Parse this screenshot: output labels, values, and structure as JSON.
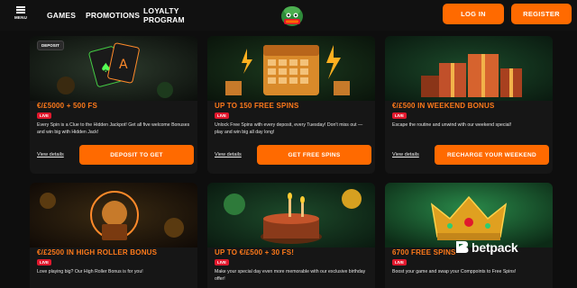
{
  "header": {
    "menu_label": "MENU",
    "nav": {
      "games": "GAMES",
      "promotions": "PROMOTIONS",
      "loyalty": "LOYALTY PROGRAM"
    },
    "login": "LOG IN",
    "register": "REGISTER",
    "logo_icon": "mascot-logo-icon"
  },
  "colors": {
    "accent": "#ff6a00",
    "title": "#ff7a1a",
    "live": "#e0182d",
    "background": "#0e0e0e"
  },
  "cards": [
    {
      "tag": "DEPOSIT",
      "title": "€/£5000 + 500 FS",
      "live": "LIVE",
      "description": "Every Spin is a Clue to the Hidden Jackpot! Get all five welcome Bonuses and win big with Hidden Jack!",
      "details": "View details",
      "cta": "DEPOSIT TO GET",
      "image_icon": "playing-cards-icon"
    },
    {
      "title": "UP TO 150 FREE SPINS",
      "live": "LIVE",
      "description": "Unlock Free Spins with every deposit, every Tuesday! Don't miss out — play and win big all day long!",
      "details": "View details",
      "cta": "GET FREE SPINS",
      "image_icon": "calendar-gifts-icon"
    },
    {
      "title": "€/£500 IN WEEKEND BONUS",
      "live": "LIVE",
      "description": "Escape the routine and unwind with our weekend special!",
      "details": "View details",
      "cta": "RECHARGE YOUR WEEKEND",
      "image_icon": "gift-boxes-icon"
    },
    {
      "title": "€/£2500 IN HIGH ROLLER BONUS",
      "live": "LIVE",
      "description": "Love playing big? Our High Roller Bonus is for you!",
      "image_icon": "high-roller-trophy-icon"
    },
    {
      "title": "UP TO €/£500 + 30 FS!",
      "live": "LIVE",
      "description": "Make your special day even more memorable with our exclusive birthday offer!",
      "image_icon": "birthday-cake-icon"
    },
    {
      "title": "6700 FREE SPINS",
      "live": "LIVE",
      "description": "Boost your game and swap your Comppoints to Free Spins!",
      "image_icon": "crown-icon",
      "brand": "betpack"
    }
  ]
}
